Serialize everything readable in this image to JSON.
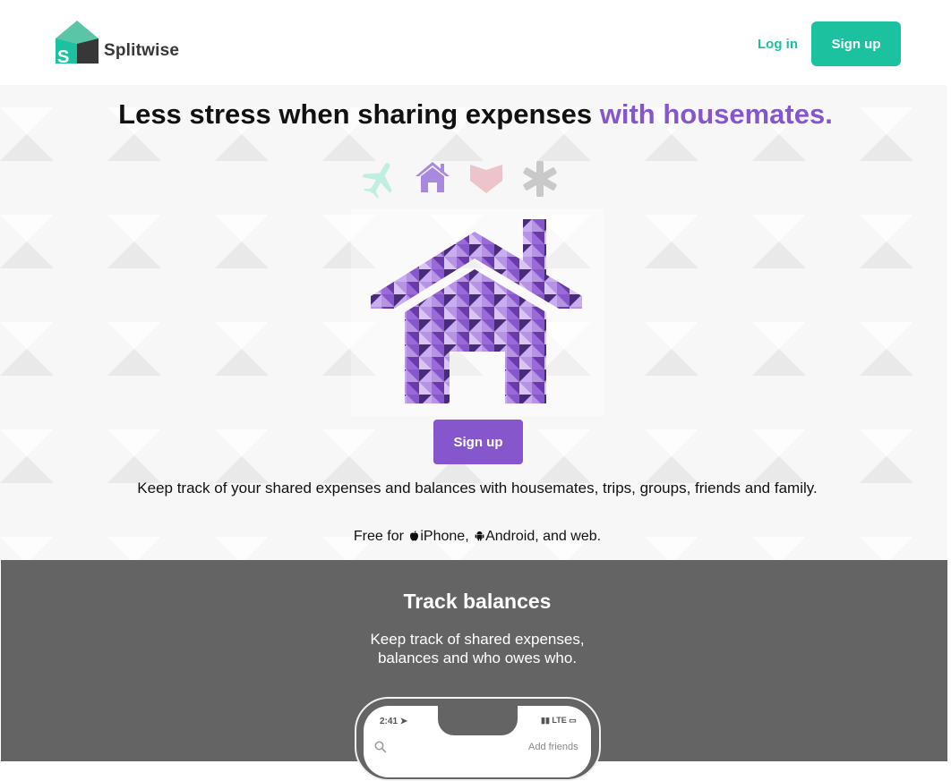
{
  "brand": {
    "name": "Splitwise",
    "colors": {
      "green": "#1cc29f",
      "purple": "#8656cd",
      "dark": "#373737",
      "feature_bg": "#646464"
    }
  },
  "nav": {
    "login": "Log in",
    "signup": "Sign up"
  },
  "hero": {
    "headline_main": "Less stress when sharing expenses ",
    "headline_accent": "with housemates.",
    "category_icons": [
      "airplane-icon",
      "home-icon",
      "heart-icon",
      "asterisk-icon"
    ],
    "illustration": "house-icon",
    "signup": "Sign up",
    "tagline": "Keep track of your shared expenses and balances with housemates, trips, groups, friends and family.",
    "platforms": {
      "prefix": "Free for",
      "ios": "iPhone,",
      "android": "Android,",
      "suffix": " and web."
    }
  },
  "feature": {
    "title": "Track balances",
    "line1": "Keep track of shared expenses,",
    "line2": "balances and who owes who.",
    "phone": {
      "time": "2:41",
      "status": "LTE",
      "action": "Add friends"
    }
  }
}
